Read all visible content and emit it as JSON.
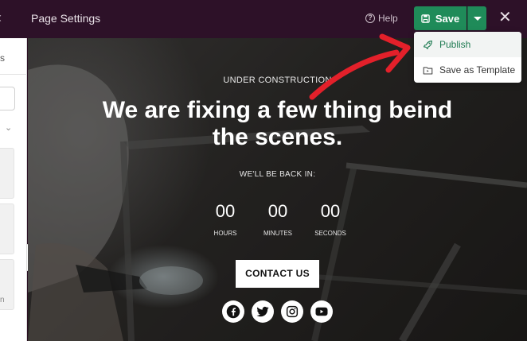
{
  "header": {
    "title": "Page Settings",
    "help_label": "Help",
    "save_label": "Save"
  },
  "save_menu": {
    "items": [
      {
        "label": "Publish",
        "icon": "rocket-icon"
      },
      {
        "label": "Save as Template",
        "icon": "folder-template-icon"
      }
    ]
  },
  "sidebar": {
    "tab_fragment": "s",
    "count_fragment": "n"
  },
  "hero": {
    "eyebrow": "UNDER CONSTRUCTION",
    "headline": "We are fixing a few thing beind the scenes.",
    "back_in": "WE'LL BE BACK IN:",
    "countdown": [
      {
        "value": "00",
        "label": "HOURS"
      },
      {
        "value": "00",
        "label": "MINUTES"
      },
      {
        "value": "00",
        "label": "SECONDS"
      }
    ],
    "cta_label": "CONTACT US",
    "social_icons": [
      "facebook-icon",
      "twitter-icon",
      "instagram-icon",
      "youtube-icon"
    ]
  },
  "colors": {
    "topbar": "#2d1128",
    "save_green": "#1f8b59",
    "publish_text": "#1f7b52",
    "annotation_arrow": "#e3202a"
  }
}
